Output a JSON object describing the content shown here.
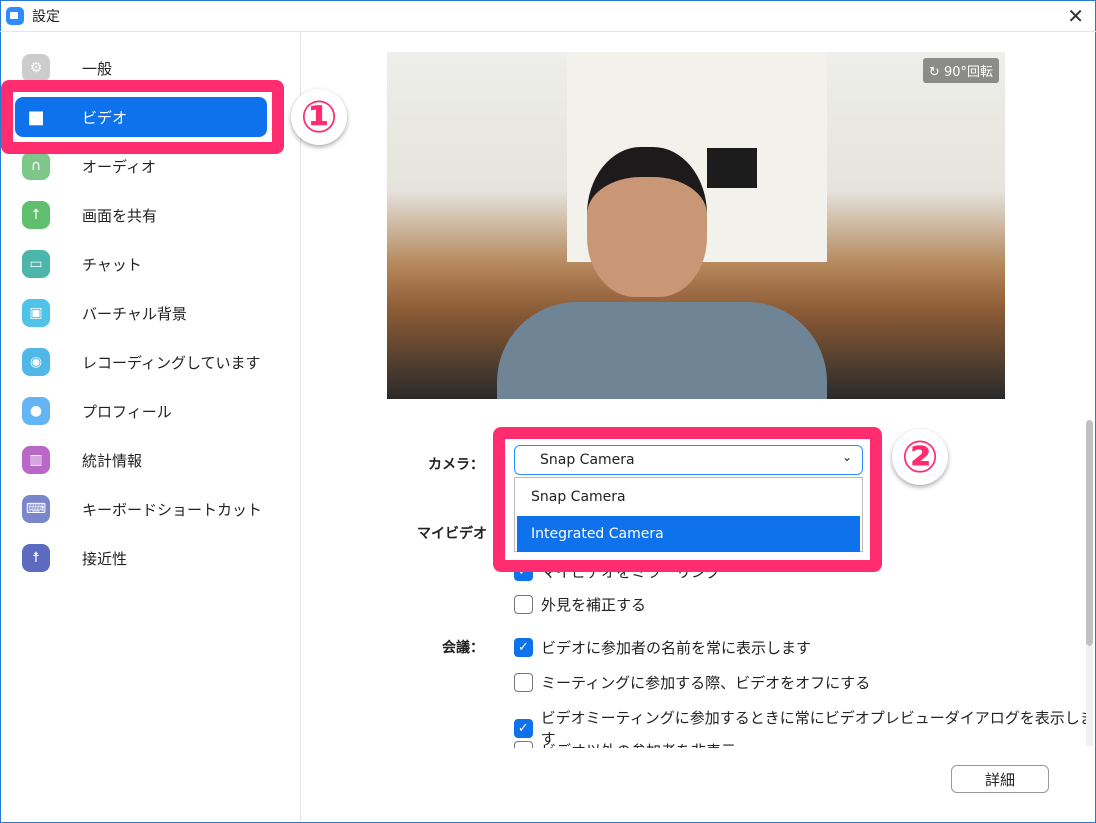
{
  "window": {
    "title": "設定",
    "close": "✕"
  },
  "sidebar": {
    "items": [
      {
        "label": "一般",
        "icon": "gear-icon",
        "color": "#cccccc",
        "glyph": "⚙"
      },
      {
        "label": "ビデオ",
        "icon": "video-camera-icon",
        "color": "#0e72ed",
        "glyph": "■"
      },
      {
        "label": "オーディオ",
        "icon": "headphones-icon",
        "color": "#7dc78a",
        "glyph": "∩"
      },
      {
        "label": "画面を共有",
        "icon": "share-screen-icon",
        "color": "#5fbf6f",
        "glyph": "↑"
      },
      {
        "label": "チャット",
        "icon": "chat-icon",
        "color": "#4db6ac",
        "glyph": "▭"
      },
      {
        "label": "バーチャル背景",
        "icon": "virtual-background-icon",
        "color": "#4fc3e8",
        "glyph": "▣"
      },
      {
        "label": "レコーディングしています",
        "icon": "recording-icon",
        "color": "#4fb8e8",
        "glyph": "◉"
      },
      {
        "label": "プロフィール",
        "icon": "profile-icon",
        "color": "#64b5f6",
        "glyph": "●"
      },
      {
        "label": "統計情報",
        "icon": "statistics-icon",
        "color": "#ba68c8",
        "glyph": "▥"
      },
      {
        "label": "キーボードショートカット",
        "icon": "keyboard-icon",
        "color": "#7986cb",
        "glyph": "⌨"
      },
      {
        "label": "接近性",
        "icon": "accessibility-icon",
        "color": "#5c6bc0",
        "glyph": "☨"
      }
    ]
  },
  "annotations": {
    "one": "①",
    "two": "②",
    "color": "#ff2d6f"
  },
  "preview": {
    "rotate": "↻ 90°回転"
  },
  "camera": {
    "label": "カメラ：",
    "selected": "Snap Camera",
    "options": [
      "Snap Camera",
      "Integrated Camera"
    ],
    "highlighted": "Integrated Camera"
  },
  "myvideo": {
    "label": "マイビデオ",
    "options": [
      {
        "text": "マイビデオをミラーリング",
        "checked": true
      },
      {
        "text": "外見を補正する",
        "checked": false
      }
    ]
  },
  "meeting": {
    "label": "会議：",
    "options": [
      {
        "text": "ビデオに参加者の名前を常に表示します",
        "checked": true
      },
      {
        "text": "ミーティングに参加する際、ビデオをオフにする",
        "checked": false
      },
      {
        "text": "ビデオミーティングに参加するときに常にビデオプレビューダイアログを表示します",
        "checked": true
      },
      {
        "text": "ビデオ以外の参加者を非表示",
        "checked": false
      }
    ]
  },
  "buttons": {
    "detail": "詳細"
  }
}
